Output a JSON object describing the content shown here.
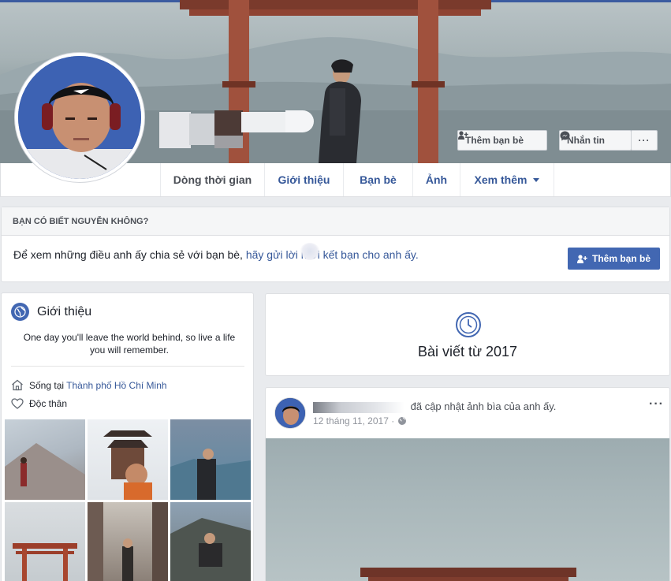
{
  "cover": {
    "add_friend_label": "Thêm bạn bè",
    "message_label": "Nhắn tin",
    "more_label": "···"
  },
  "tabs": [
    {
      "label": "Dòng thời gian"
    },
    {
      "label": "Giới thiệu"
    },
    {
      "label": "Bạn bè"
    },
    {
      "label": "Ảnh"
    },
    {
      "label": "Xem thêm"
    }
  ],
  "suggest": {
    "heading": "BẠN CÓ BIẾT NGUYỄN KHÔNG?",
    "text": "Để xem những điều anh ấy chia sẻ với bạn bè, ",
    "link": "hãy gửi lời mời kết bạn cho anh ấy.",
    "button": "Thêm bạn bè"
  },
  "intro": {
    "title": "Giới thiệu",
    "bio": "One day you'll leave the world behind, so live a life you will remember.",
    "lives_prefix": "Sống tại ",
    "lives_city": "Thành phố Hồ Chí Minh",
    "relationship": "Độc thân"
  },
  "year_card": {
    "label": "Bài viết từ 2017"
  },
  "post": {
    "action": "đã cập nhật ảnh bìa của anh ấy.",
    "date": "12 tháng 11, 2017 ·",
    "more": "···"
  },
  "colors": {
    "brand": "#4267b2",
    "link": "#365899",
    "background": "#e9ebee"
  }
}
